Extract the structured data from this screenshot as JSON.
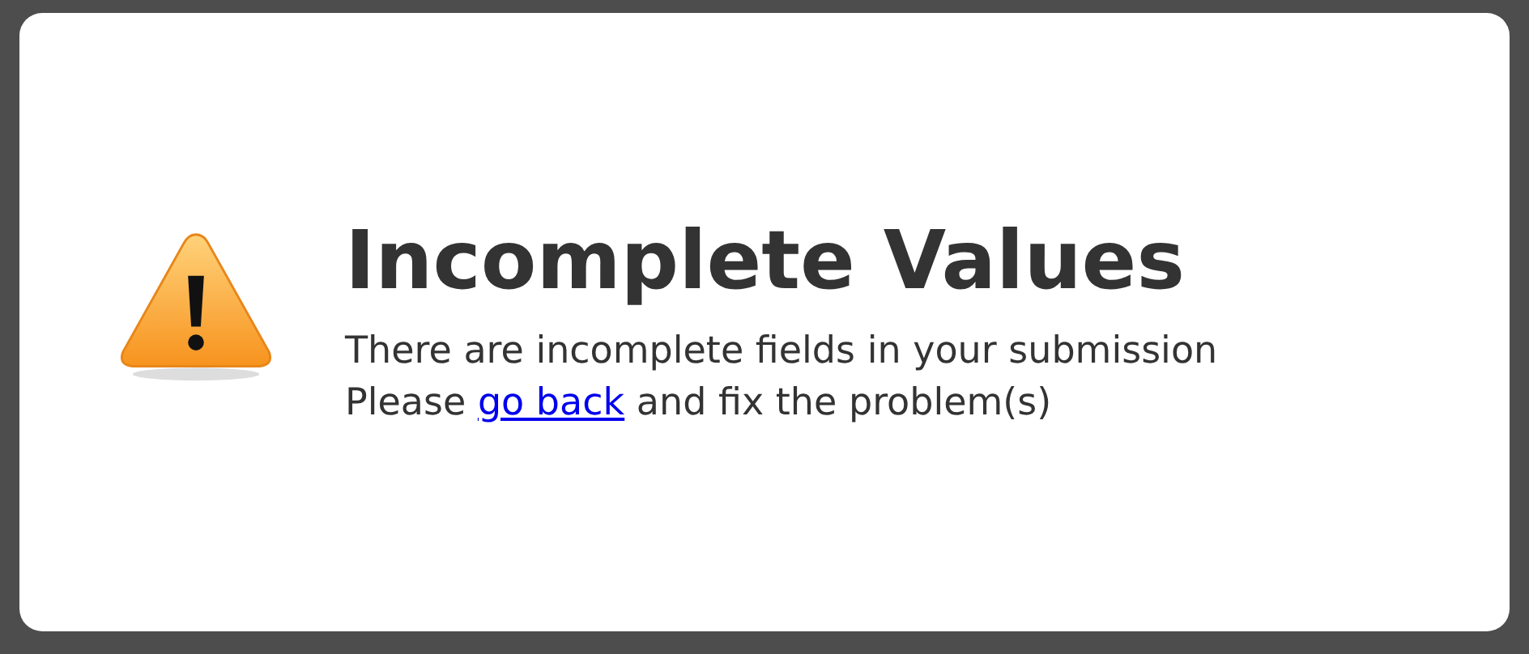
{
  "title": "Incomplete Values",
  "lines": [
    {
      "before": "There are incomplete fields in your submission"
    },
    {
      "before": "Please ",
      "link": "go back",
      "after": " and fix the problem(s)"
    }
  ]
}
